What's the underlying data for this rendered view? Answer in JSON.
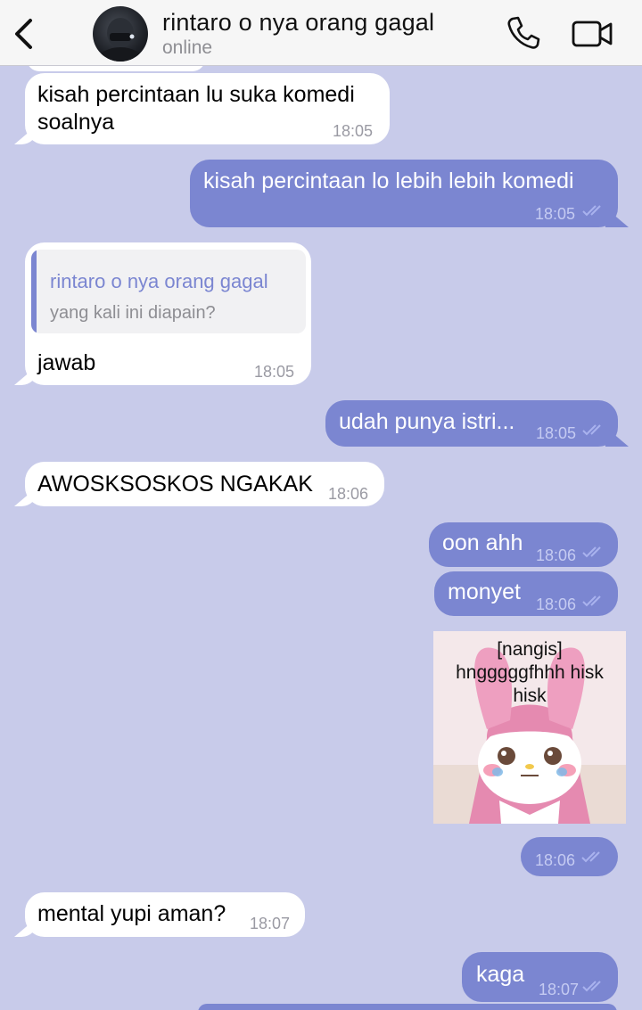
{
  "header": {
    "contact_name": "rintaro o nya orang gagal",
    "status": "online",
    "icons": {
      "back": "chevron-left-icon",
      "call": "phone-icon",
      "video": "video-camera-icon"
    }
  },
  "colors": {
    "background": "#c8cbea",
    "outgoing_bubble": "#7b86d1",
    "incoming_bubble": "#ffffff",
    "accent": "#7b86d1"
  },
  "messages": [
    {
      "direction": "in",
      "text_line1": "kisah percintaan lu suka komedi",
      "text_line2": "soalnya",
      "time": "18:05"
    },
    {
      "direction": "out",
      "text": "kisah percintaan lo lebih lebih komedi",
      "time": "18:05",
      "read": true
    },
    {
      "direction": "in",
      "reply_to_name": "rintaro o nya orang gagal",
      "reply_to_text": "yang kali ini diapain?",
      "text": "jawab",
      "time": "18:05"
    },
    {
      "direction": "out",
      "text": "udah punya istri...",
      "time": "18:05",
      "read": true
    },
    {
      "direction": "in",
      "text": "AWOSKSOSKOS NGAKAK",
      "time": "18:06"
    },
    {
      "direction": "out",
      "text": "oon ahh",
      "time": "18:06",
      "read": true
    },
    {
      "direction": "out",
      "text": "monyet",
      "time": "18:06",
      "read": true
    },
    {
      "direction": "out",
      "type": "sticker",
      "sticker_caption_line1": "[nangis]",
      "sticker_caption_line2": "hngggggfhhh hisk",
      "sticker_caption_line3": "hisk",
      "time": "18:06",
      "read": true
    },
    {
      "direction": "in",
      "text": "mental yupi aman?",
      "time": "18:07"
    },
    {
      "direction": "out",
      "text": "kaga",
      "time": "18:07",
      "read": true
    }
  ]
}
